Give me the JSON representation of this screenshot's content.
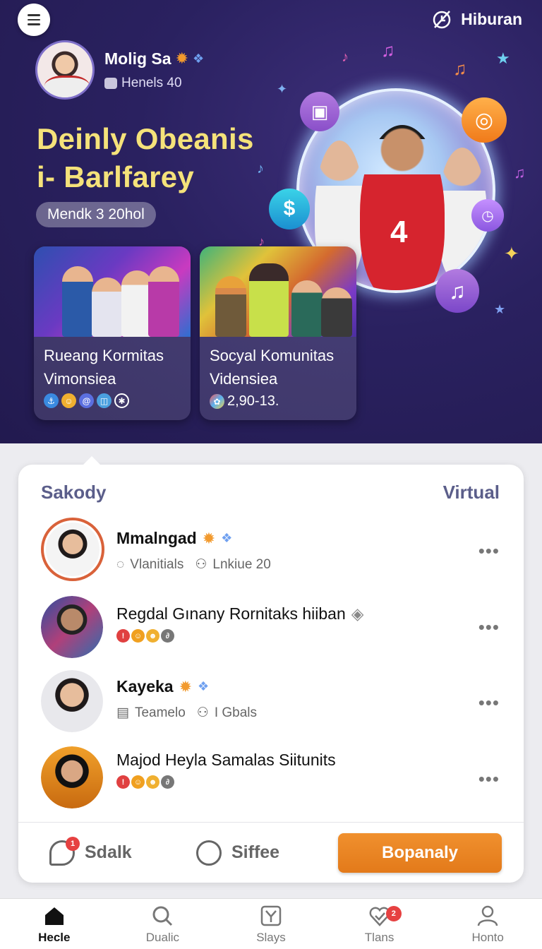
{
  "header": {
    "right_label": "Hiburan"
  },
  "profile": {
    "name": "Molig Sa",
    "sub": "Henels 40"
  },
  "hero": {
    "headline_line1": "Deinly Obeanis",
    "headline_line2": "i- Barlfarey",
    "pill": "Mendk 3 20hol",
    "jersey_number": "4"
  },
  "cards": [
    {
      "title_line1": "Rueang Kormitas",
      "title_line2": "Vimonsiea",
      "meta": ""
    },
    {
      "title_line1": "Socyal Komunitas",
      "title_line2": "Vidensiea",
      "meta": "2,90-13."
    }
  ],
  "panel": {
    "left_title": "Sakody",
    "right_title": "Virtual",
    "rows": [
      {
        "name": "Mmalngad",
        "sub1": "Vlanitials",
        "sub2": "Lnkiue 20"
      },
      {
        "name": "Regdal Gınany Rornitaks hiiban"
      },
      {
        "name": "Kayeka",
        "sub1": "Teamelo",
        "sub2": "I Gbals"
      },
      {
        "name": "Majod Heyla Samalas Siitunits"
      }
    ],
    "more": "•••",
    "footer": {
      "btn1": "Sdalk",
      "btn1_badge": "1",
      "btn2": "Siffee",
      "primary": "Bopanaly"
    }
  },
  "nav": {
    "items": [
      "Hecle",
      "Dualic",
      "Slays",
      "Tlans",
      "Honto"
    ],
    "badge": "2"
  },
  "colors": {
    "hero_bg": "#2a2160",
    "headline": "#f5e27a",
    "accent_orange": "#e37a1a",
    "panel_title": "#5b5e8a"
  }
}
